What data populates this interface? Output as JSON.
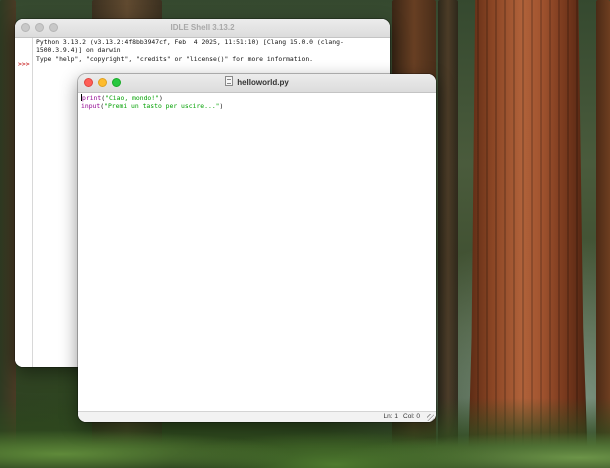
{
  "shell": {
    "title": "IDLE Shell 3.13.2",
    "lines": [
      "Python 3.13.2 (v3.13.2:4f8bb3947cf, Feb  4 2025, 11:51:10) [Clang 15.0.0 (clang-",
      "1500.3.9.4)] on darwin",
      "Type \"help\", \"copyright\", \"credits\" or \"license()\" for more information."
    ],
    "prompt": ">>>"
  },
  "editor": {
    "title": "helloworld.py",
    "code": [
      {
        "func": "print",
        "open": "(",
        "string": "\"Ciao, mondo!\"",
        "close": ")"
      },
      {
        "func": "input",
        "open": "(",
        "string": "\"Premi un tasto per uscire...\"",
        "close": ")"
      }
    ],
    "status": {
      "line": "Ln: 1",
      "col": "Col: 0"
    }
  },
  "colors": {
    "keyword": "#900090",
    "string": "#00a000",
    "prompt": "#c00000",
    "close_button": "#ff5f57",
    "minimize_button": "#febc2e",
    "zoom_button": "#28c840"
  }
}
